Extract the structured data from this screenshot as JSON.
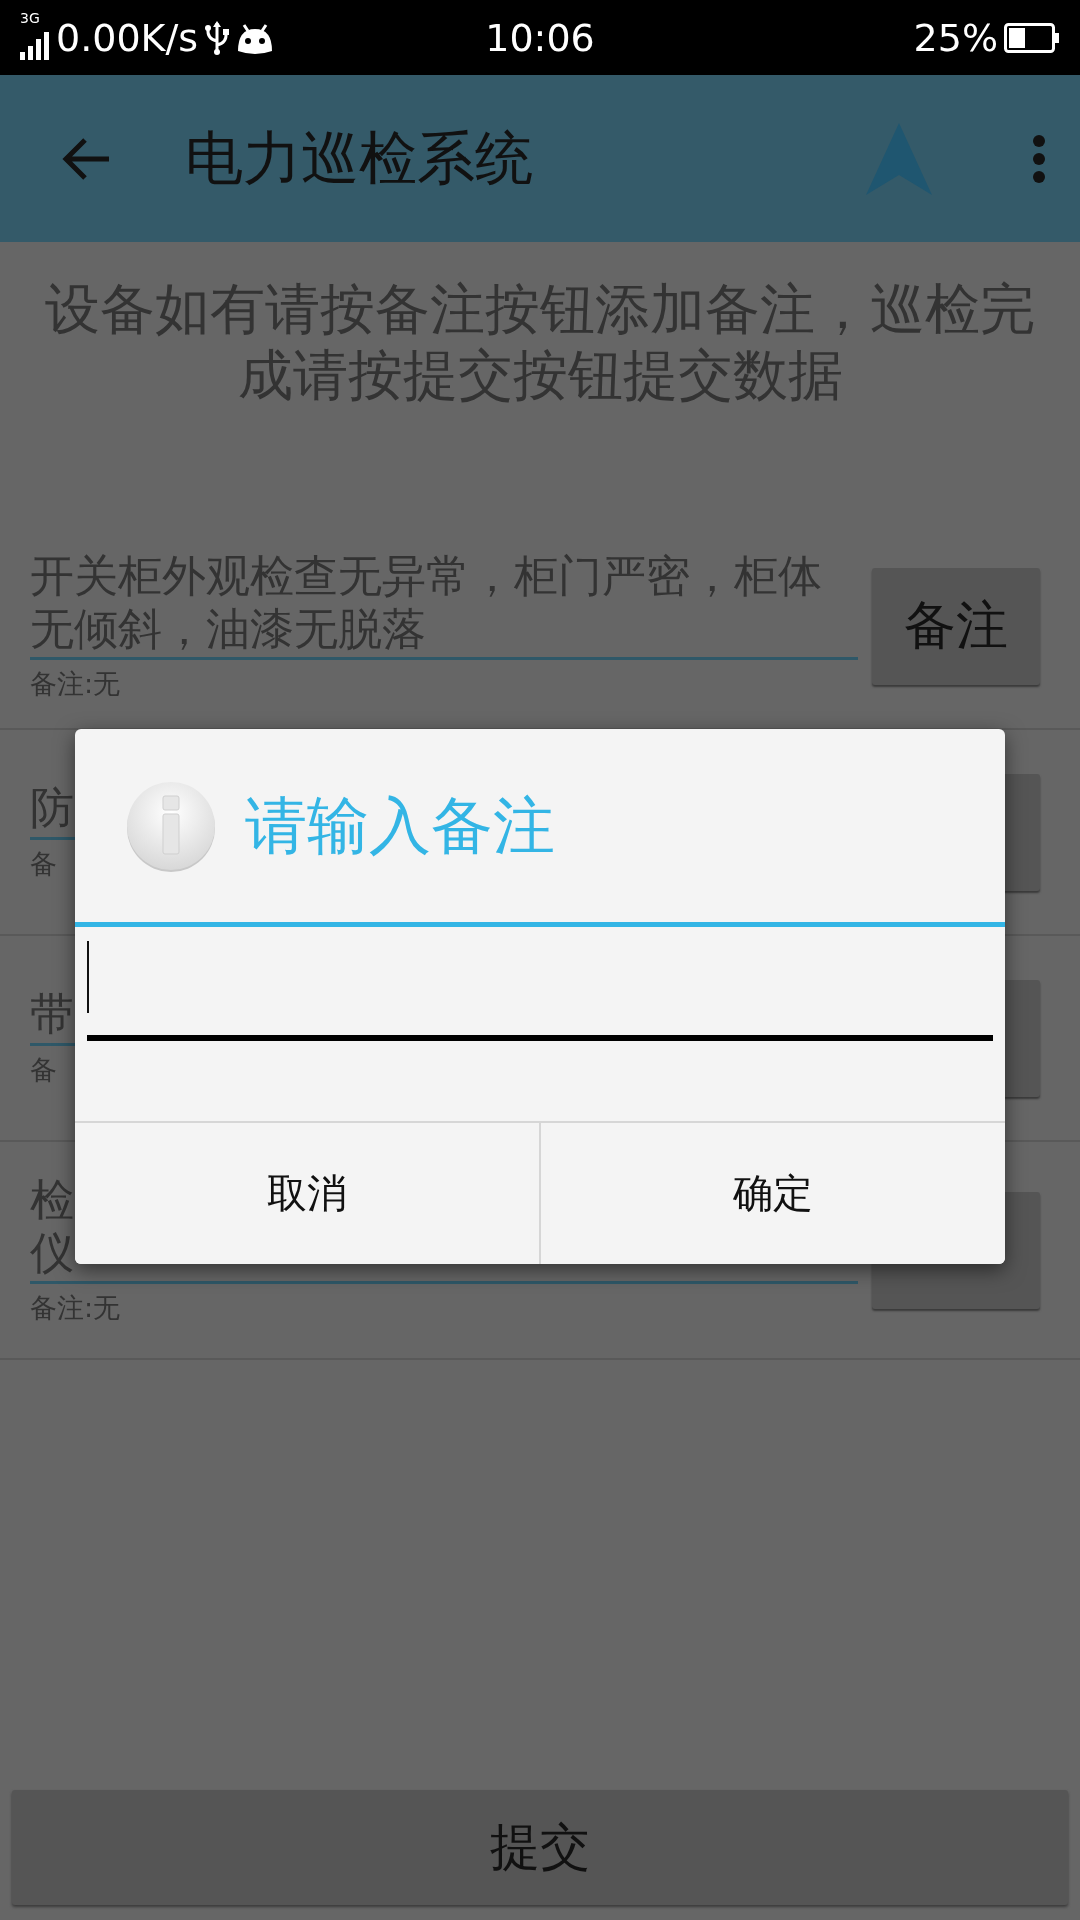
{
  "status_bar": {
    "network": "3G",
    "speed": "0.00K/s",
    "time": "10:06",
    "battery": "25%"
  },
  "app_bar": {
    "title": "电力巡检系统"
  },
  "instruction": "设备如有请按备注按钮添加备注，巡检完成请按提交按钮提交数据",
  "items": [
    {
      "title_lines": [
        "开关柜外观检查无异常，柜门严密，柜体",
        "无倾斜，油漆无脱落"
      ],
      "note": "备注:无",
      "button": "备注"
    },
    {
      "title_lines": [
        "防"
      ],
      "note": "备"
    },
    {
      "title_lines": [
        "带"
      ],
      "note": "备"
    },
    {
      "title_lines": [
        "检",
        "仪"
      ],
      "note": "备注:无"
    }
  ],
  "submit": "提交",
  "dialog": {
    "title": "请输入备注",
    "buttons": [
      "取消",
      "确定"
    ]
  }
}
